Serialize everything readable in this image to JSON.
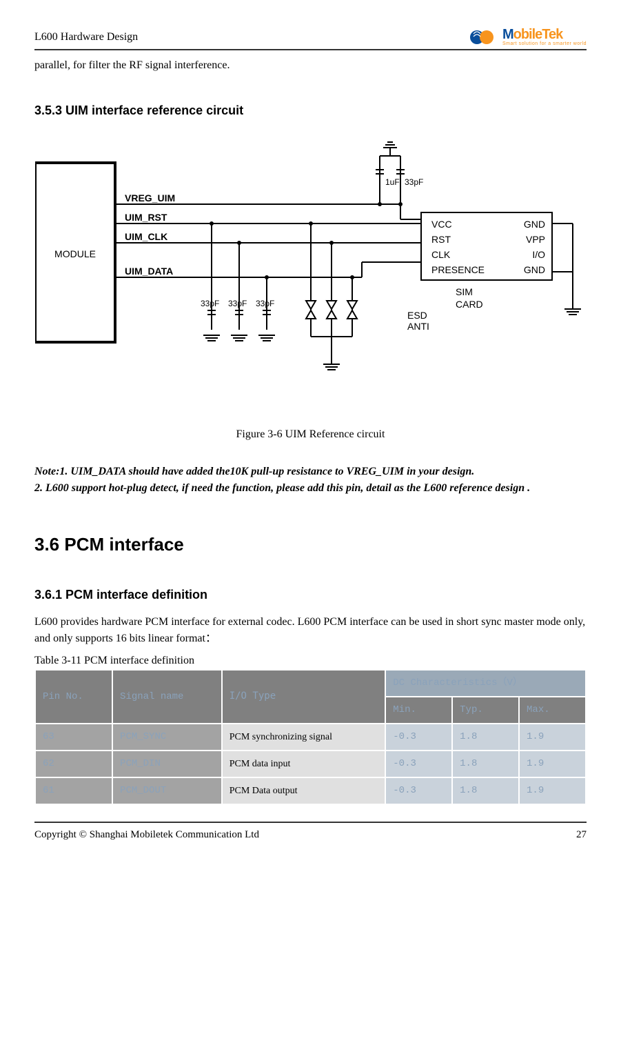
{
  "header": {
    "doc_title": "L600 Hardware Design",
    "logo_brand_1": "M",
    "logo_brand_2": "obileTek",
    "logo_tagline": "Smart solution for a smarter world"
  },
  "continuation_text": "parallel, for filter the RF signal interference.",
  "section_353_title": "3.5.3 UIM interface reference circuit",
  "figure_caption": "Figure 3-6 UIM Reference circuit",
  "note_text": "Note:1. UIM_DATA should have added the10K pull-up resistance to VREG_UIM in your design.\n       2. L600 support hot-plug detect, if need the function, please add this pin, detail as the L600 reference design .",
  "section_36_title": "3.6 PCM interface",
  "section_361_title": "3.6.1 PCM interface definition",
  "pcm_intro": "L600 provides hardware PCM interface for external codec. L600 PCM interface can be used in short sync master mode only, and only supports 16 bits linear format：",
  "table_caption": "Table 3-11 PCM interface definition",
  "table": {
    "headers": {
      "pin_no": "Pin No.",
      "signal": "Signal name",
      "io": "I/O Type",
      "dc": "DC Characteristics（V）",
      "min": "Min.",
      "typ": "Typ.",
      "max": "Max."
    },
    "rows": [
      {
        "pin": "63",
        "signal": "PCM_SYNC",
        "io": "PCM synchronizing signal",
        "min": "-0.3",
        "typ": "1.8",
        "max": "1.9"
      },
      {
        "pin": "62",
        "signal": "PCM_DIN",
        "io": "PCM data input",
        "min": "-0.3",
        "typ": "1.8",
        "max": "1.9"
      },
      {
        "pin": "61",
        "signal": "PCM_DOUT",
        "io": "PCM Data output",
        "min": "-0.3",
        "typ": "1.8",
        "max": "1.9"
      }
    ]
  },
  "footer": {
    "copyright": "Copyright © Shanghai Mobiletek Communication Ltd",
    "page": "27"
  },
  "schematic": {
    "module": "MODULE",
    "signals": [
      "VREG_UIM",
      "UIM_RST",
      "UIM_CLK",
      "UIM_DATA"
    ],
    "caps_top": [
      "1uF",
      "33pF"
    ],
    "caps_bottom": [
      "33pF",
      "33pF",
      "33pF"
    ],
    "esd": "ESD\nANTI",
    "card_label": "SIM\nCARD",
    "card_pins_left": [
      "VCC",
      "RST",
      "CLK",
      "PRESENCE"
    ],
    "card_pins_right": [
      "GND",
      "VPP",
      "I/O",
      "GND"
    ]
  }
}
